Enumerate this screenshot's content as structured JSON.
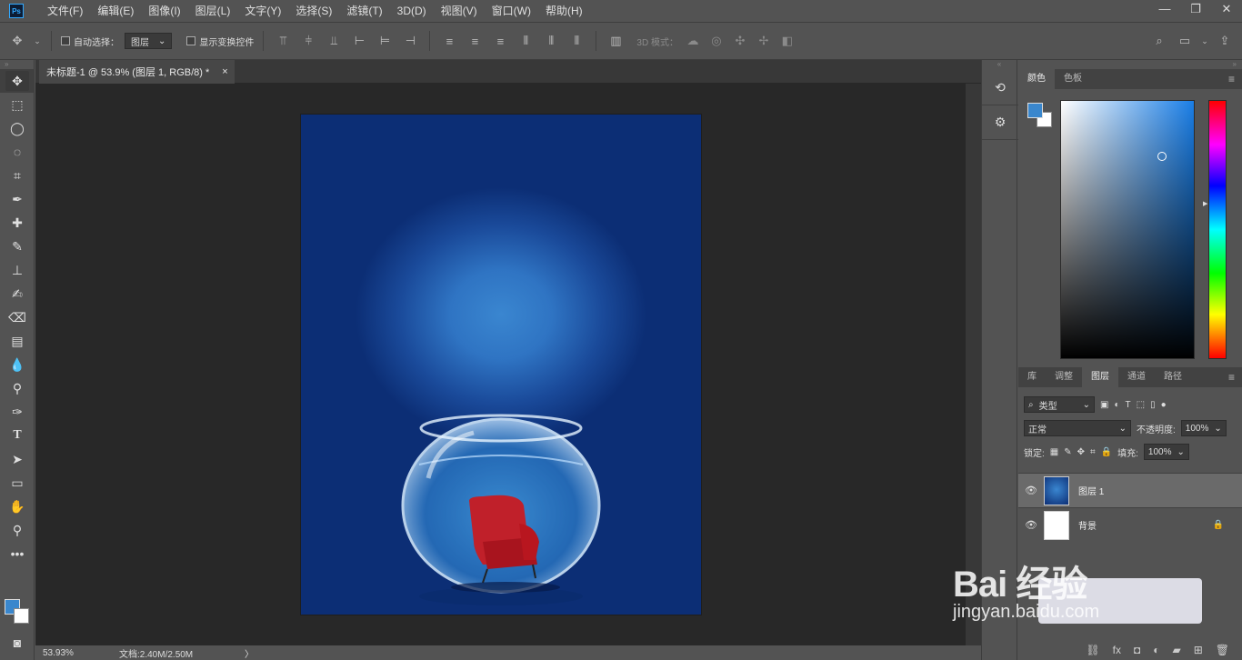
{
  "app": {
    "logo": "Ps",
    "menus": [
      "文件(F)",
      "编辑(E)",
      "图像(I)",
      "图层(L)",
      "文字(Y)",
      "选择(S)",
      "滤镜(T)",
      "3D(D)",
      "视图(V)",
      "窗口(W)",
      "帮助(H)"
    ]
  },
  "window_controls": {
    "minimize": "—",
    "restore": "❐",
    "close": "✕"
  },
  "options": {
    "auto_select_label": "自动选择：",
    "layer_select": "图层",
    "show_transform_label": "显示变换控件",
    "mode3d_label": "3D 模式："
  },
  "document": {
    "tab_title": "未标题-1 @ 53.9% (图层 1, RGB/8) *",
    "close": "×"
  },
  "status": {
    "zoom": "53.93%",
    "docinfo": "文档:2.40M/2.50M",
    "arrow": "〉"
  },
  "color_panel": {
    "tabs": [
      "颜色",
      "色板"
    ],
    "fg": "#3a87cd",
    "bg": "#ffffff"
  },
  "layers_panel": {
    "tabs": [
      "库",
      "调整",
      "图层",
      "通道",
      "路径"
    ],
    "filter_label": "类型",
    "blend_mode": "正常",
    "opacity_label": "不透明度:",
    "opacity": "100%",
    "lock_label": "锁定:",
    "fill_label": "填充:",
    "fill": "100%",
    "layers": [
      {
        "name": "图层 1",
        "selected": true
      },
      {
        "name": "背景",
        "locked": true
      }
    ]
  },
  "watermark": {
    "main": "Bai 经验",
    "url": "jingyan.baidu.com"
  }
}
